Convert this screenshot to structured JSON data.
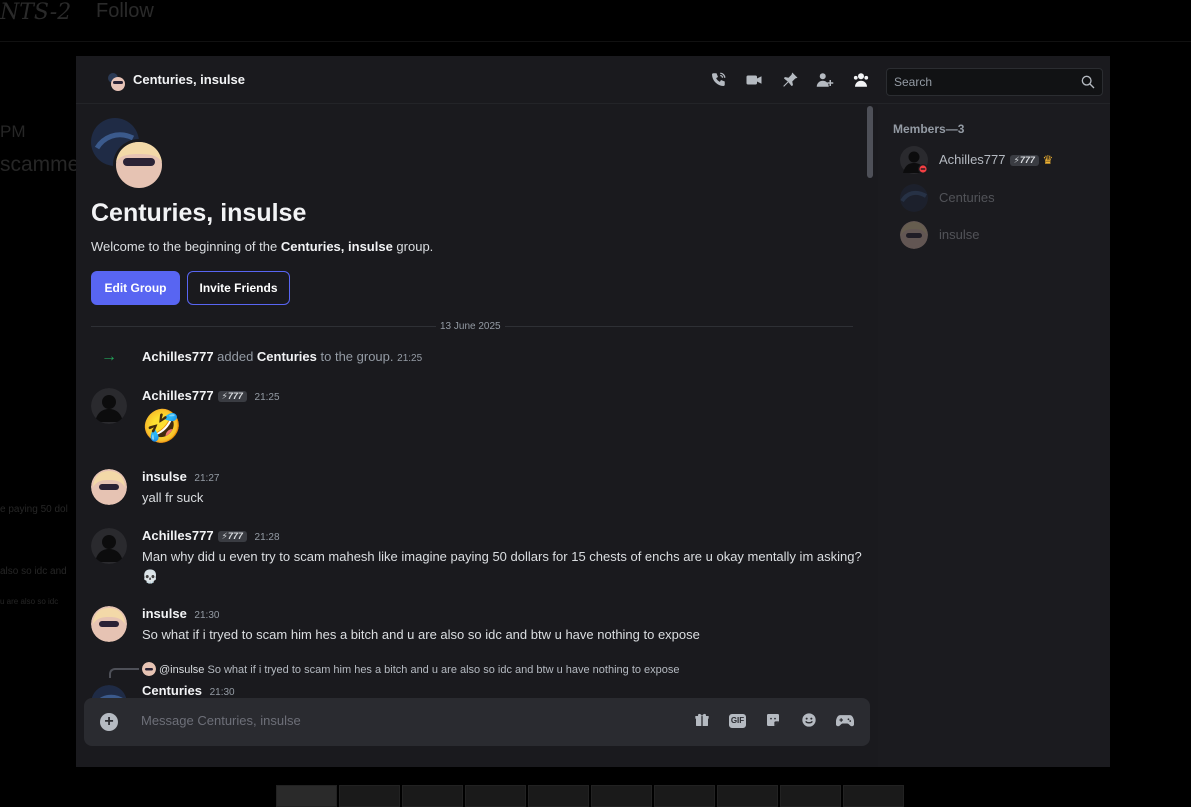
{
  "background": {
    "title": "NTS-2",
    "follow": "Follow",
    "fragments": [
      "PM",
      "scamme",
      "e paying 50 dol",
      "also so idc and",
      "u are also so idc"
    ]
  },
  "dm": {
    "title": "Centuries, insulse",
    "search_placeholder": "Search",
    "header_icons": [
      "phone-call-icon",
      "video-call-icon",
      "pin-icon",
      "add-friend-icon",
      "members-list-icon"
    ],
    "intro": {
      "group_name": "Centuries, insulse",
      "welcome_prefix": "Welcome to the beginning of the ",
      "welcome_bold": "Centuries, insulse",
      "welcome_suffix": " group.",
      "edit_button": "Edit Group",
      "invite_button": "Invite Friends"
    },
    "date_divider": "13 June 2025",
    "system_message": {
      "actor": "Achilles777",
      "action": " added ",
      "target": "Centuries",
      "suffix": " to the group.",
      "time": "21:25"
    },
    "messages": [
      {
        "user": "Achilles777",
        "badge": "⚡777",
        "time": "21:25",
        "text": "🤣"
      },
      {
        "user": "insulse",
        "badge": "",
        "time": "21:27",
        "text": "yall fr suck"
      },
      {
        "user": "Achilles777",
        "badge": "⚡777",
        "time": "21:28",
        "text": "Man why did u even try to scam mahesh like imagine paying 50 dollars for 15 chests of enchs are u okay mentally im asking? 💀"
      },
      {
        "user": "insulse",
        "badge": "",
        "time": "21:30",
        "text": "So what if i tryed to scam him hes a bitch and u are also so idc and btw u have nothing to expose"
      },
      {
        "user": "Centuries",
        "badge": "",
        "time": "21:30",
        "text": ""
      }
    ],
    "reply_preview": {
      "mention": "@insulse",
      "text": " So what if i tryed to scam him hes a bitch and u are also so idc and btw u have nothing to expose"
    },
    "composer": {
      "placeholder": "Message Centuries, insulse",
      "icons": [
        "gift-icon",
        "gif-icon",
        "sticker-icon",
        "emoji-icon",
        "activity-icon"
      ],
      "gif_label": "GIF"
    },
    "members": {
      "heading": "Members—3",
      "list": [
        {
          "name": "Achilles777",
          "badge": "⚡777",
          "owner": true
        },
        {
          "name": "Centuries",
          "badge": "",
          "owner": false
        },
        {
          "name": "insulse",
          "badge": "",
          "owner": false
        }
      ]
    },
    "colors": {
      "accent": "#5865f2",
      "online_arrow": "#23a55a",
      "owner_crown": "#f0b232",
      "dnd": "#f23f43"
    }
  }
}
